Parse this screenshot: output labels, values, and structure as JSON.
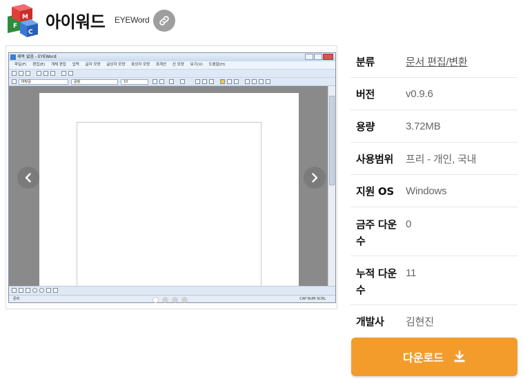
{
  "header": {
    "title": "아이워드",
    "subtitle": "EYEWord",
    "logo_letters": [
      "M",
      "F",
      "C"
    ]
  },
  "screenshot": {
    "window_title": "제목 없음 - EYEWord",
    "menu": [
      "파일(F)",
      "편집(E)",
      "개체 편집",
      "입력",
      "글자 모양",
      "글상자 모양",
      "표상자 모양",
      "표계산",
      "선 모양",
      "보기(V)",
      "도움말(H)"
    ],
    "font_combo": "바탕글",
    "style_combo": "굴림",
    "size_combo": "10",
    "status_left": "준비",
    "status_right": "CAP  NUM  SCRL",
    "slide_count": 4,
    "active_slide": 0
  },
  "info": [
    {
      "key": "분류",
      "value": "문서 편집/변환",
      "link": true
    },
    {
      "key": "버전",
      "value": "v0.9.6"
    },
    {
      "key": "용량",
      "value": "3.72MB"
    },
    {
      "key": "사용범위",
      "value": "프리 - 개인, 국내"
    },
    {
      "key": "지원 OS",
      "value": "Windows"
    },
    {
      "key": "금주 다운수",
      "value": "0"
    },
    {
      "key": "누적 다운수",
      "value": "11"
    },
    {
      "key": "개발사",
      "value": "김현진"
    }
  ],
  "download": {
    "label": "다운로드"
  },
  "colors": {
    "accent": "#f39c2c",
    "link_button": "#9e9e9e"
  },
  "icons": [
    "link-icon",
    "chevron-left-icon",
    "chevron-right-icon",
    "download-icon"
  ]
}
